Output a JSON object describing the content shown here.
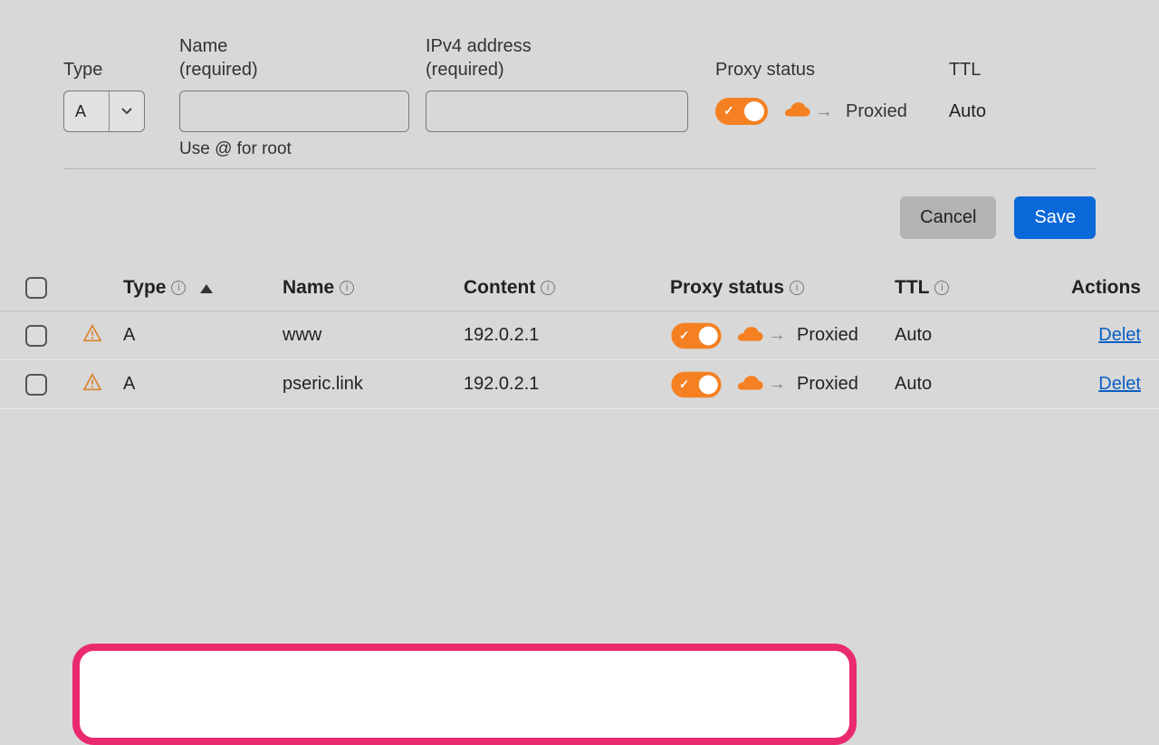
{
  "form": {
    "type": {
      "label": "Type",
      "value": "A"
    },
    "name": {
      "label": "Name",
      "required_text": "(required)",
      "value": "",
      "helper": "Use @ for root"
    },
    "ipv4": {
      "label": "IPv4 address",
      "required_text": "(required)",
      "value": ""
    },
    "proxy": {
      "label": "Proxy status",
      "value_label": "Proxied",
      "on": true
    },
    "ttl": {
      "label": "TTL",
      "value": "Auto"
    }
  },
  "buttons": {
    "cancel": "Cancel",
    "save": "Save"
  },
  "table": {
    "headers": {
      "type": "Type",
      "name": "Name",
      "content": "Content",
      "proxy": "Proxy status",
      "ttl": "TTL",
      "actions": "Actions"
    },
    "rows": [
      {
        "type": "A",
        "name": "www",
        "content": "192.0.2.1",
        "proxy_label": "Proxied",
        "ttl": "Auto",
        "action": "Delet"
      },
      {
        "type": "A",
        "name": "pseric.link",
        "content": "192.0.2.1",
        "proxy_label": "Proxied",
        "ttl": "Auto",
        "action": "Delet"
      }
    ]
  }
}
